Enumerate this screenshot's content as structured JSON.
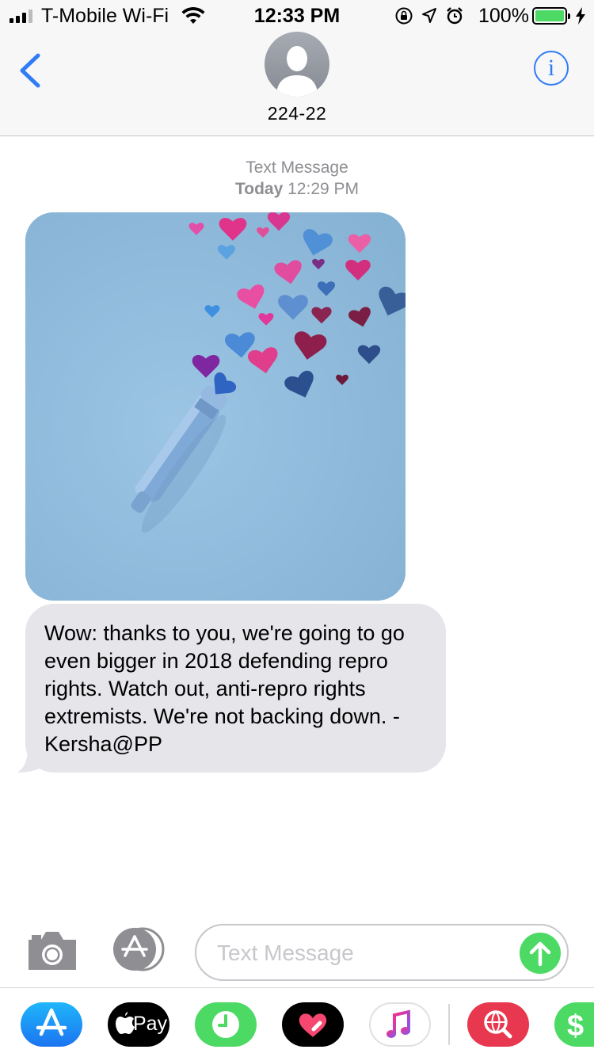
{
  "status_bar": {
    "carrier": "T-Mobile Wi-Fi",
    "time": "12:33 PM",
    "battery": "100%",
    "icons": [
      "signal-bars-icon",
      "wifi-icon",
      "orientation-lock-icon",
      "location-icon",
      "alarm-icon",
      "battery-icon",
      "charging-bolt-icon"
    ]
  },
  "header": {
    "back_icon": "chevron-left-icon",
    "contact_name": "224-22",
    "info_glyph": "i"
  },
  "conversation": {
    "service_label": "Text Message",
    "day_label": "Today",
    "time_label": "12:29 PM",
    "messages": [
      {
        "type": "image",
        "direction": "incoming",
        "content": "hearts-illustration"
      },
      {
        "type": "text",
        "direction": "incoming",
        "text": "Wow: thanks to you, we're going to go even bigger in 2018 defending repro rights. Watch out, anti-repro rights extremists. We're not backing down. -Kersha@PP"
      }
    ]
  },
  "composer": {
    "placeholder": "Text Message",
    "camera_icon": "camera-icon",
    "apps_icon": "app-store-icon",
    "send_icon": "send-arrow-icon",
    "send_color": "#4cd964"
  },
  "app_drawer": {
    "apple_pay_label": "Pay",
    "apps": [
      "app-store",
      "apple-pay",
      "recents",
      "digital-touch",
      "music",
      "web-images",
      "cash"
    ]
  },
  "colors": {
    "accent_blue": "#2f7cf6",
    "incoming_bubble": "#e5e5ea",
    "send_green": "#4cd964"
  }
}
